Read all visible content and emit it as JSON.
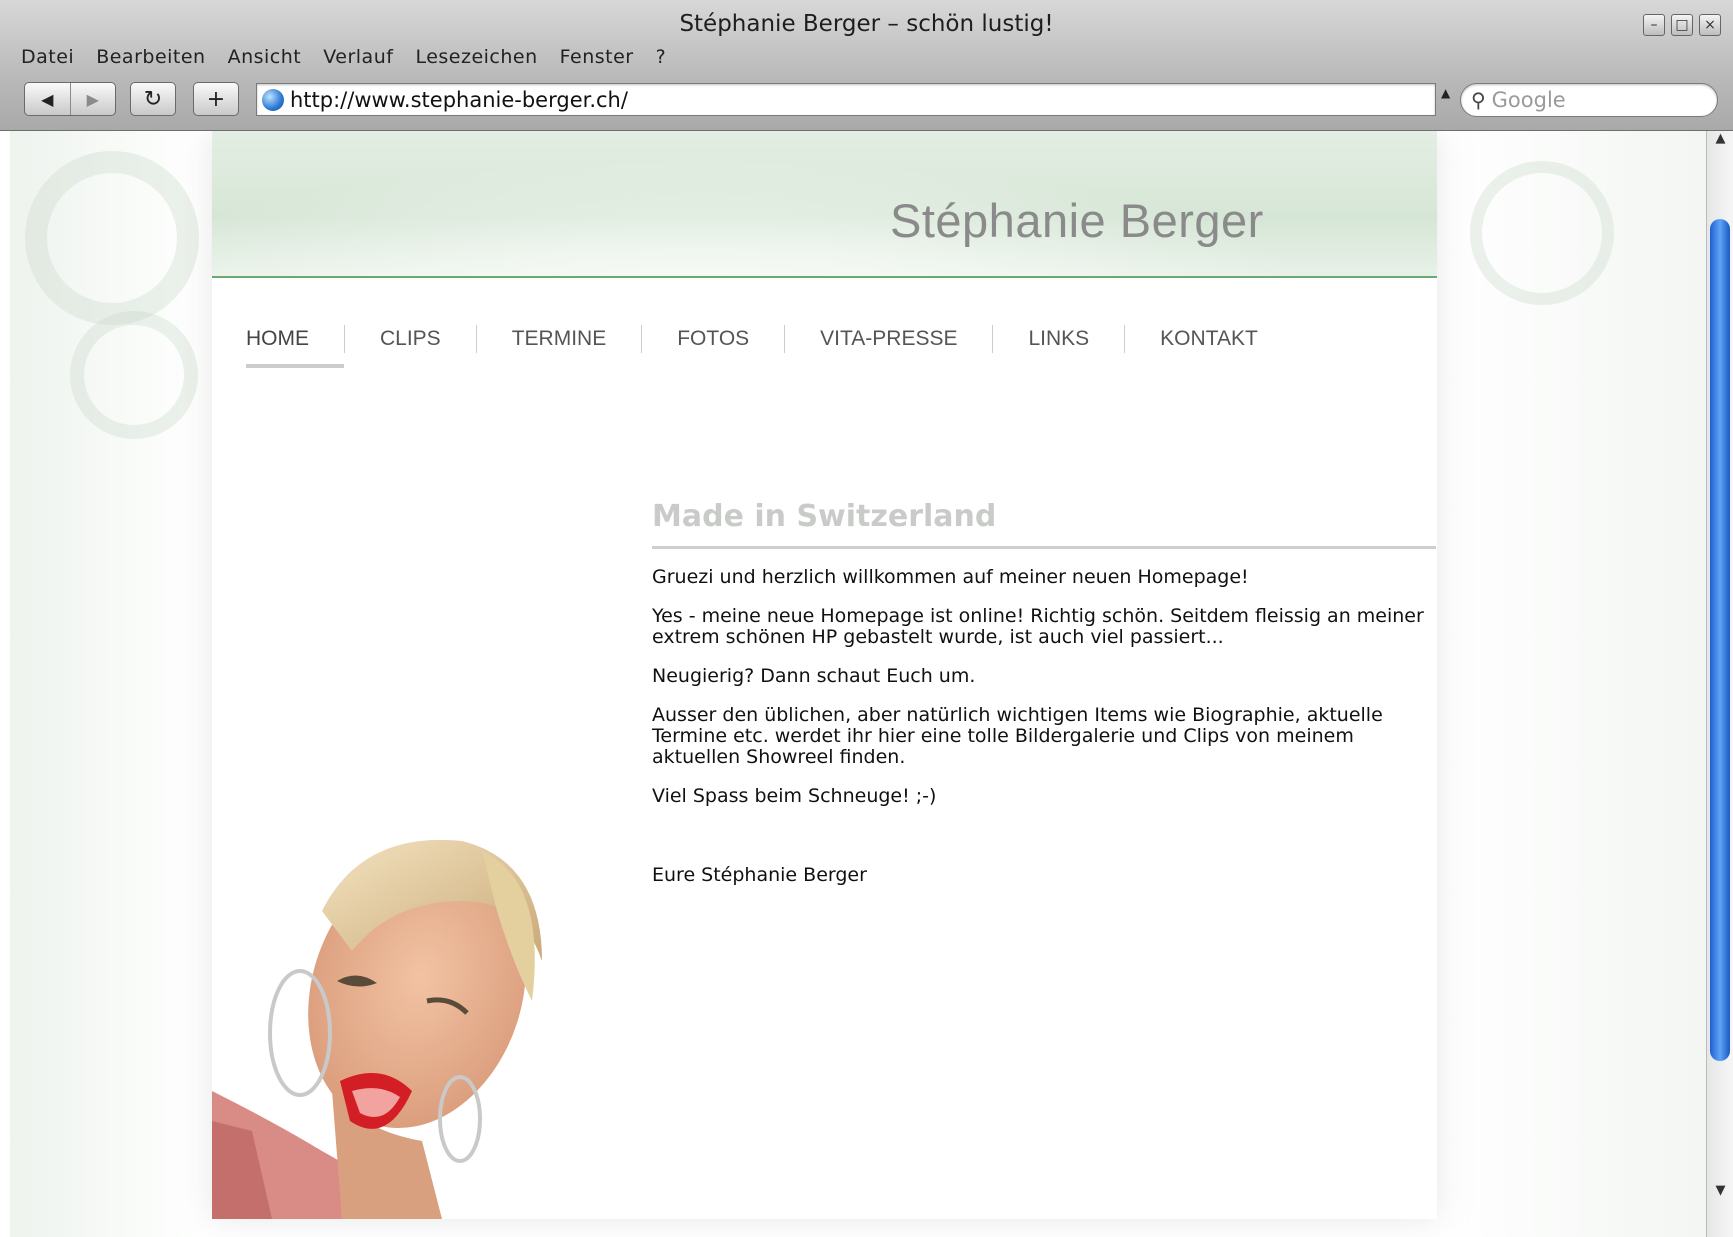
{
  "window": {
    "title": "Stéphanie Berger – schön lustig!",
    "buttons": [
      "minimize",
      "maximize",
      "close"
    ]
  },
  "menu": [
    "Datei",
    "Bearbeiten",
    "Ansicht",
    "Verlauf",
    "Lesezeichen",
    "Fenster",
    "?"
  ],
  "toolbar": {
    "back_icon": "◀",
    "forward_icon": "▶",
    "reload_icon": "↻",
    "add_icon": "+",
    "url": "http://www.stephanie-berger.ch/",
    "search_placeholder": "Google"
  },
  "site": {
    "title": "Stéphanie Berger",
    "nav": [
      "HOME",
      "CLIPS",
      "TERMINE",
      "FOTOS",
      "VITA-PRESSE",
      "LINKS",
      "KONTAKT"
    ],
    "active_nav": "HOME",
    "heading": "Made in Switzerland",
    "paragraphs": [
      "Gruezi und herzlich willkommen auf meiner neuen Homepage!",
      "Yes - meine neue Homepage ist online! Richtig schön. Seitdem fleissig an meiner extrem schönen HP gebastelt wurde, ist auch viel passiert...",
      "Neugierig? Dann schaut Euch um.",
      "Ausser den üblichen, aber natürlich wichtigen Items wie Biographie, aktuelle Termine etc. werdet ihr hier eine tolle Bildergalerie und Clips von meinem aktuellen Showreel finden.",
      "Viel Spass beim Schneuge! ;-)"
    ],
    "signature": "Eure Stéphanie Berger"
  },
  "colors": {
    "header_green": "#d6e6d6",
    "header_line": "#6aa96f",
    "scroll_thumb": "#3a82e6"
  }
}
